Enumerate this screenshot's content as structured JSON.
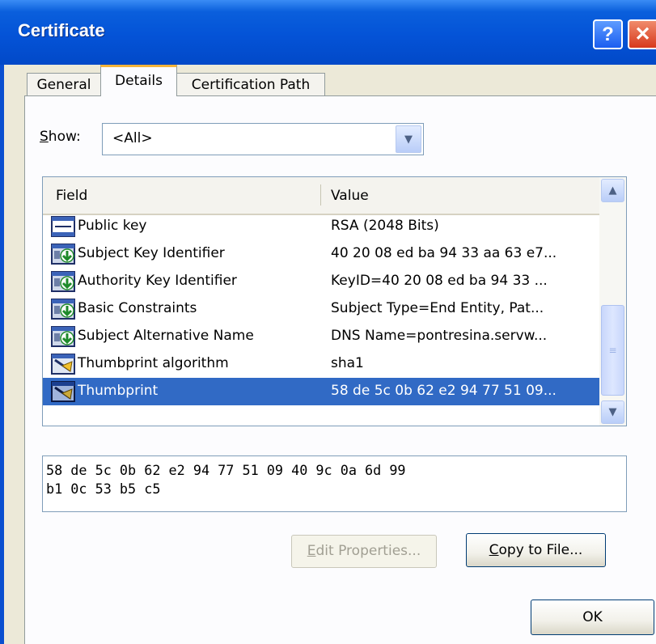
{
  "window": {
    "title": "Certificate"
  },
  "titlebar": {
    "help_glyph": "?",
    "close_glyph": "✕"
  },
  "tabs": [
    {
      "label": "General",
      "active": false
    },
    {
      "label": "Details",
      "active": true
    },
    {
      "label": "Certification Path",
      "active": false
    }
  ],
  "show": {
    "label_key": "S",
    "label_rest": "how:",
    "selected": "<All>"
  },
  "list": {
    "columns": {
      "field": "Field",
      "value": "Value"
    },
    "rows": [
      {
        "field": "Public key",
        "value": "RSA (2048 Bits)",
        "icon": "certificate-field-icon",
        "selected": false
      },
      {
        "field": "Subject Key Identifier",
        "value": "40 20 08 ed ba 94 33 aa 63 e7...",
        "icon": "certificate-extension-icon",
        "selected": false
      },
      {
        "field": "Authority Key Identifier",
        "value": "KeyID=40 20 08 ed ba 94 33 ...",
        "icon": "certificate-extension-icon",
        "selected": false
      },
      {
        "field": "Basic Constraints",
        "value": "Subject Type=End Entity, Pat...",
        "icon": "certificate-extension-icon",
        "selected": false
      },
      {
        "field": "Subject Alternative Name",
        "value": "DNS Name=pontresina.servw...",
        "icon": "certificate-extension-icon",
        "selected": false
      },
      {
        "field": "Thumbprint algorithm",
        "value": "sha1",
        "icon": "certificate-property-icon",
        "selected": false
      },
      {
        "field": "Thumbprint",
        "value": "58 de 5c 0b 62 e2 94 77 51 09...",
        "icon": "certificate-property-icon",
        "selected": true
      }
    ]
  },
  "detail": {
    "value": "58 de 5c 0b 62 e2 94 77 51 09 40 9c 0a 6d 99\nb1 0c 53 b5 c5"
  },
  "buttons": {
    "edit": {
      "key": "E",
      "rest": "dit Properties...",
      "enabled": false
    },
    "copy": {
      "key": "C",
      "rest": "opy to File...",
      "enabled": true
    },
    "ok": {
      "label": "OK"
    }
  },
  "colors": {
    "title_bar": "#0453d7",
    "selection": "#316ac5",
    "dialog_face": "#ece9d8",
    "active_tab_accent": "#f4b43a"
  }
}
